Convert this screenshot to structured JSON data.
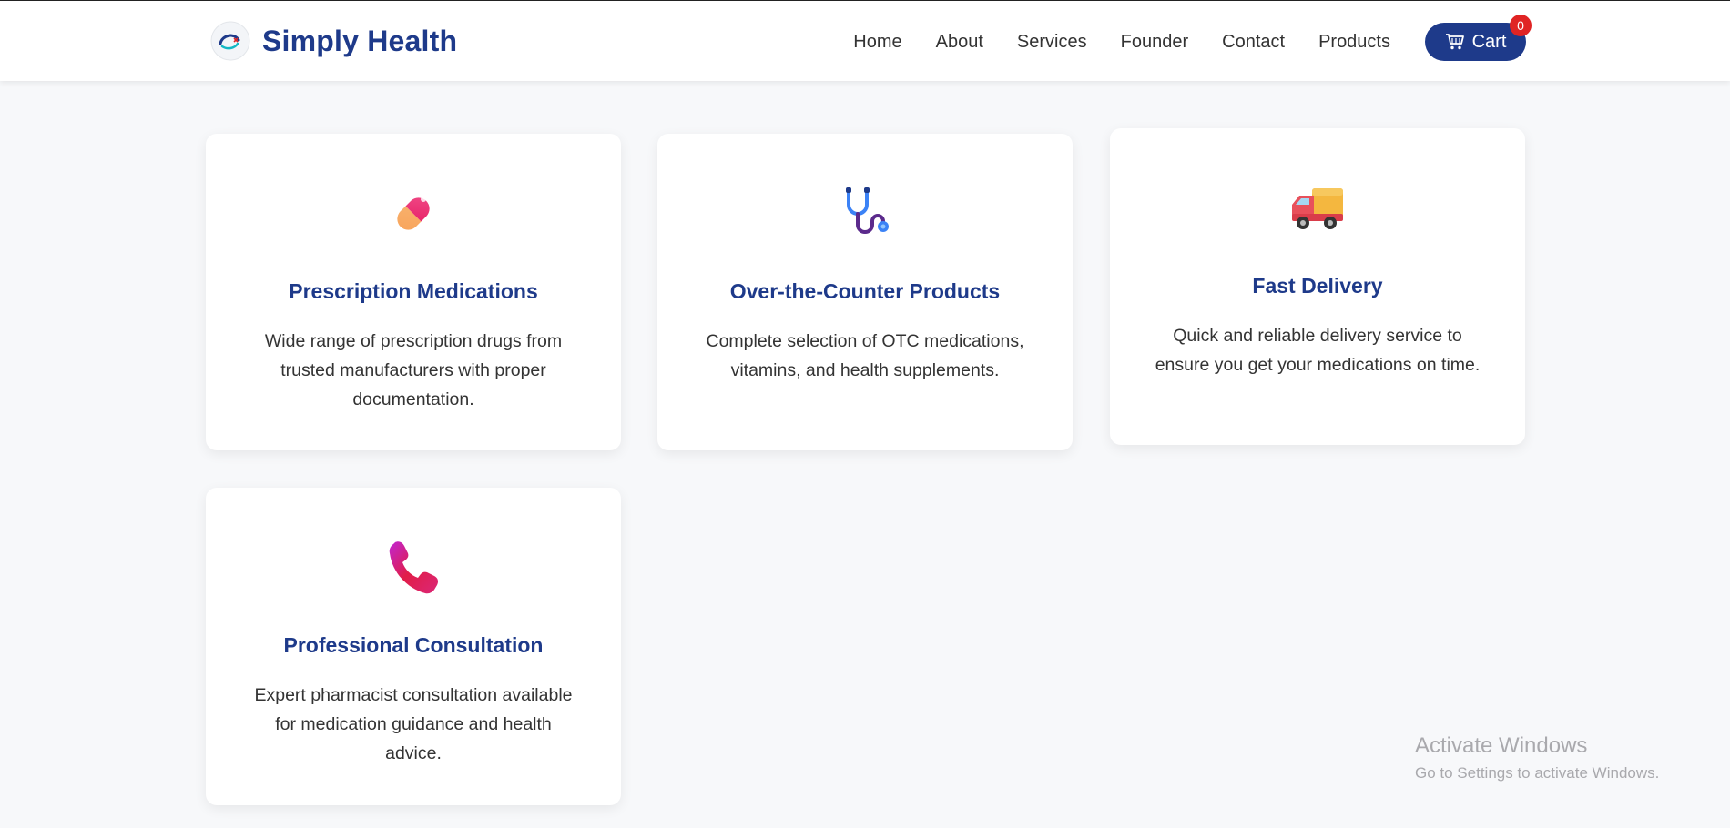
{
  "header": {
    "brand_name": "Simply Health",
    "nav": [
      "Home",
      "About",
      "Services",
      "Founder",
      "Contact",
      "Products"
    ],
    "cart_label": "Cart",
    "cart_count": "0"
  },
  "services": [
    {
      "icon": "pill-icon",
      "title": "Prescription Medications",
      "description": "Wide range of prescription drugs from trusted manufacturers with proper documentation."
    },
    {
      "icon": "stethoscope-icon",
      "title": "Over-the-Counter Products",
      "description": "Complete selection of OTC medications, vitamins, and health supplements."
    },
    {
      "icon": "delivery-truck-icon",
      "title": "Fast Delivery",
      "description": "Quick and reliable delivery service to ensure you get your medications on time."
    },
    {
      "icon": "phone-icon",
      "title": "Professional Consultation",
      "description": "Expert pharmacist consultation available for medication guidance and health advice."
    }
  ],
  "watermark": {
    "line1": "Activate Windows",
    "line2": "Go to Settings to activate Windows."
  },
  "colors": {
    "brand": "#1e3a8a",
    "badge": "#e02424",
    "background": "#f7f8fa"
  }
}
